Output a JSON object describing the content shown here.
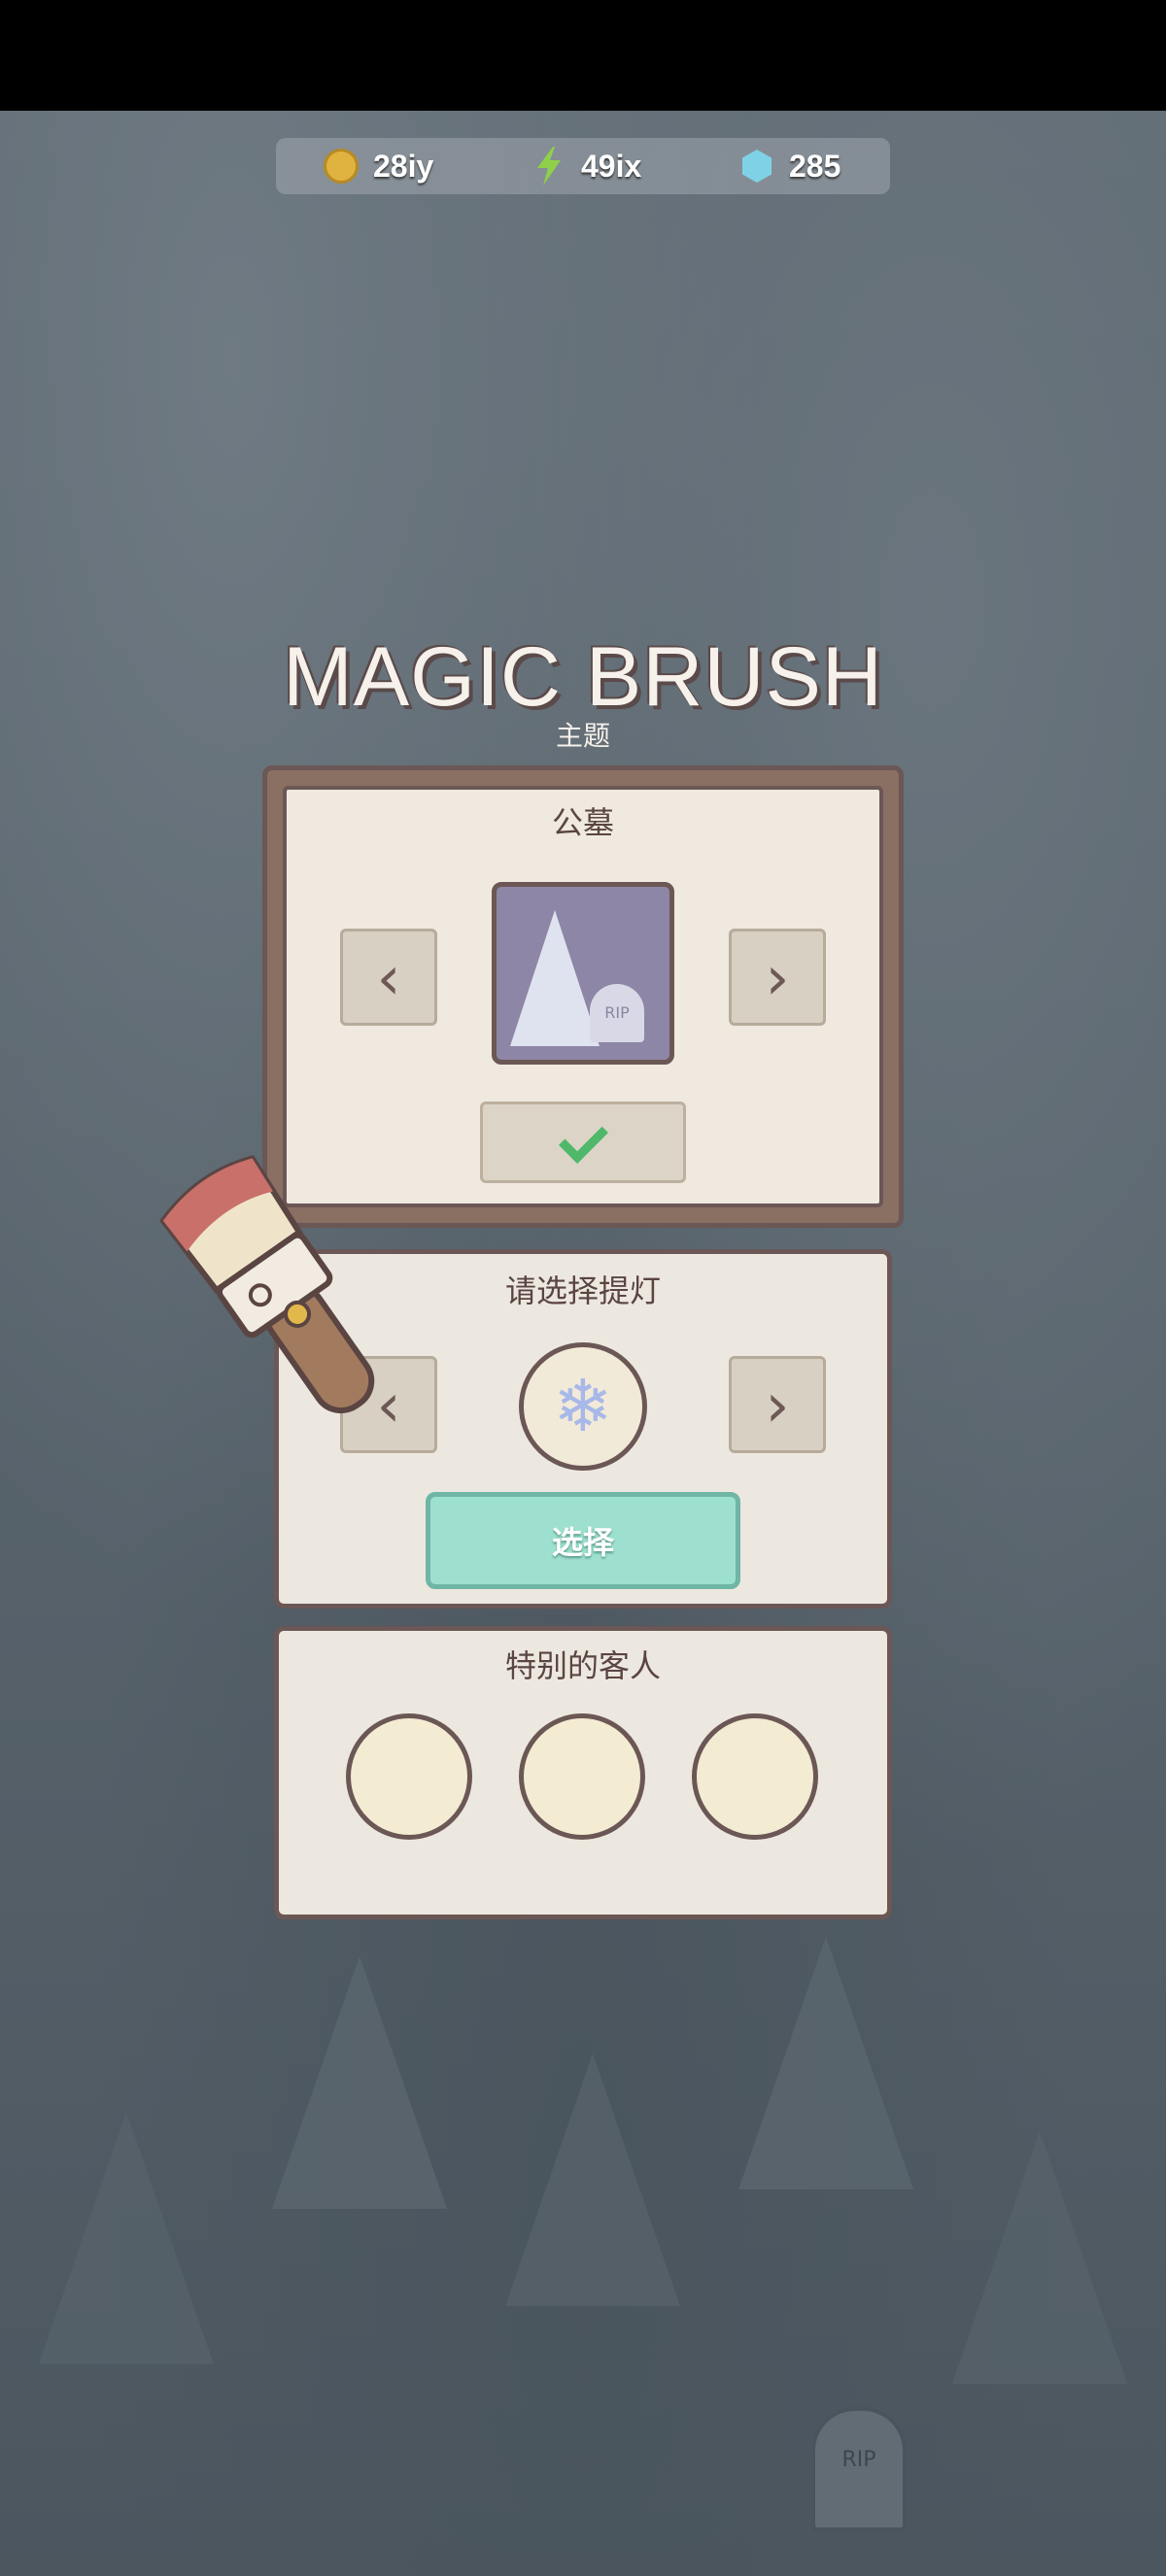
{
  "resources": {
    "coins": "28iy",
    "energy": "49ix",
    "gems": "285"
  },
  "screen": {
    "title": "MAGIC BRUSH",
    "subtitle": "主题"
  },
  "theme_panel": {
    "title": "公墓",
    "prev_glyph": "‹",
    "next_glyph": "›",
    "preview_text": "RIP"
  },
  "lantern_panel": {
    "title": "请选择提灯",
    "prev_glyph": "‹",
    "next_glyph": "›",
    "icon_glyph": "❄",
    "select_label": "选择"
  },
  "guests_panel": {
    "title": "特别的客人",
    "slots": [
      "",
      "",
      ""
    ]
  },
  "background": {
    "tombstone_text": "RIP"
  },
  "icons": {
    "coin": "coin-icon",
    "energy": "lightning-icon",
    "gem": "gem-icon"
  },
  "colors": {
    "panel_bg": "#ede8df",
    "panel_border": "#6b5755",
    "select_button": "#9ee0cf",
    "check": "#4fb86a"
  }
}
